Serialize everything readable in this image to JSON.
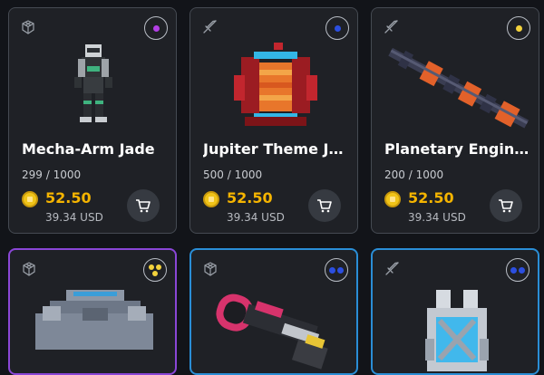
{
  "cards": [
    {
      "name": "Mecha-Arm Jade",
      "supply": "299 / 1000",
      "price": "52.50",
      "usd": "39.34 USD",
      "type_icon": "cube-icon",
      "rarity_color": "#b33fe6"
    },
    {
      "name": "Jupiter Theme Je...",
      "supply": "500 / 1000",
      "price": "52.50",
      "usd": "39.34 USD",
      "type_icon": "sword-icon",
      "rarity_color": "#2c4fe0"
    },
    {
      "name": "Planetary Engine...",
      "supply": "200 / 1000",
      "price": "52.50",
      "usd": "39.34 USD",
      "type_icon": "sword-icon",
      "rarity_color": "#f3d23c"
    },
    {
      "type_icon": "cube-icon",
      "rarity_colors": [
        "#f3d23c",
        "#f3d23c",
        "#f3d23c"
      ],
      "border": "#8a46d6"
    },
    {
      "type_icon": "cube-icon",
      "rarity_colors": [
        "#2c4fe0",
        "#2c4fe0"
      ],
      "border": "#2a8ed6"
    },
    {
      "type_icon": "sword-icon",
      "rarity_colors": [
        "#2c4fe0",
        "#2c4fe0"
      ],
      "border": "#2a8ed6"
    }
  ]
}
